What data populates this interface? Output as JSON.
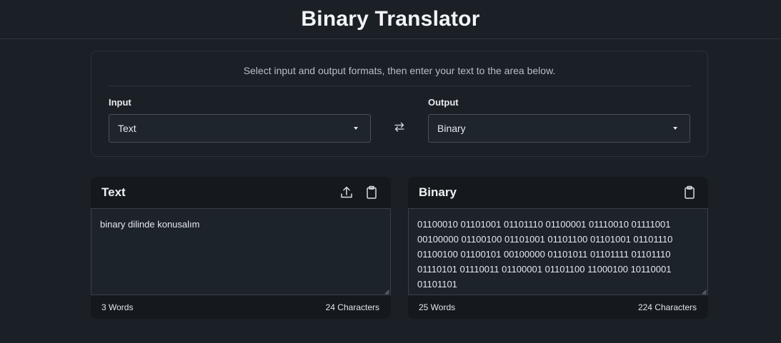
{
  "app": {
    "title": "Binary Translator"
  },
  "settings": {
    "hint": "Select input and output formats, then enter your text to the area below.",
    "input": {
      "label": "Input",
      "selected": "Text"
    },
    "output": {
      "label": "Output",
      "selected": "Binary"
    },
    "swap_icon": "swap-arrows-icon"
  },
  "input_panel": {
    "title": "Text",
    "content": "binary dilinde konusalım",
    "words": "3 Words",
    "characters": "24 Characters",
    "icons": [
      "upload-icon",
      "clipboard-icon"
    ]
  },
  "output_panel": {
    "title": "Binary",
    "content": "01100010 01101001 01101110 01100001 01110010 01111001 00100000 01100100 01101001 01101100 01101001 01101110 01100100 01100101 00100000 01101011 01101111 01101110 01110101 01110011 01100001 01101100 11000100 10110001 01101101",
    "words": "25 Words",
    "characters": "224 Characters",
    "icons": [
      "clipboard-icon"
    ]
  },
  "colors": {
    "background": "#1b2027",
    "panel": "#15191e",
    "textarea": "#1d232b",
    "border": "#3a4048"
  }
}
